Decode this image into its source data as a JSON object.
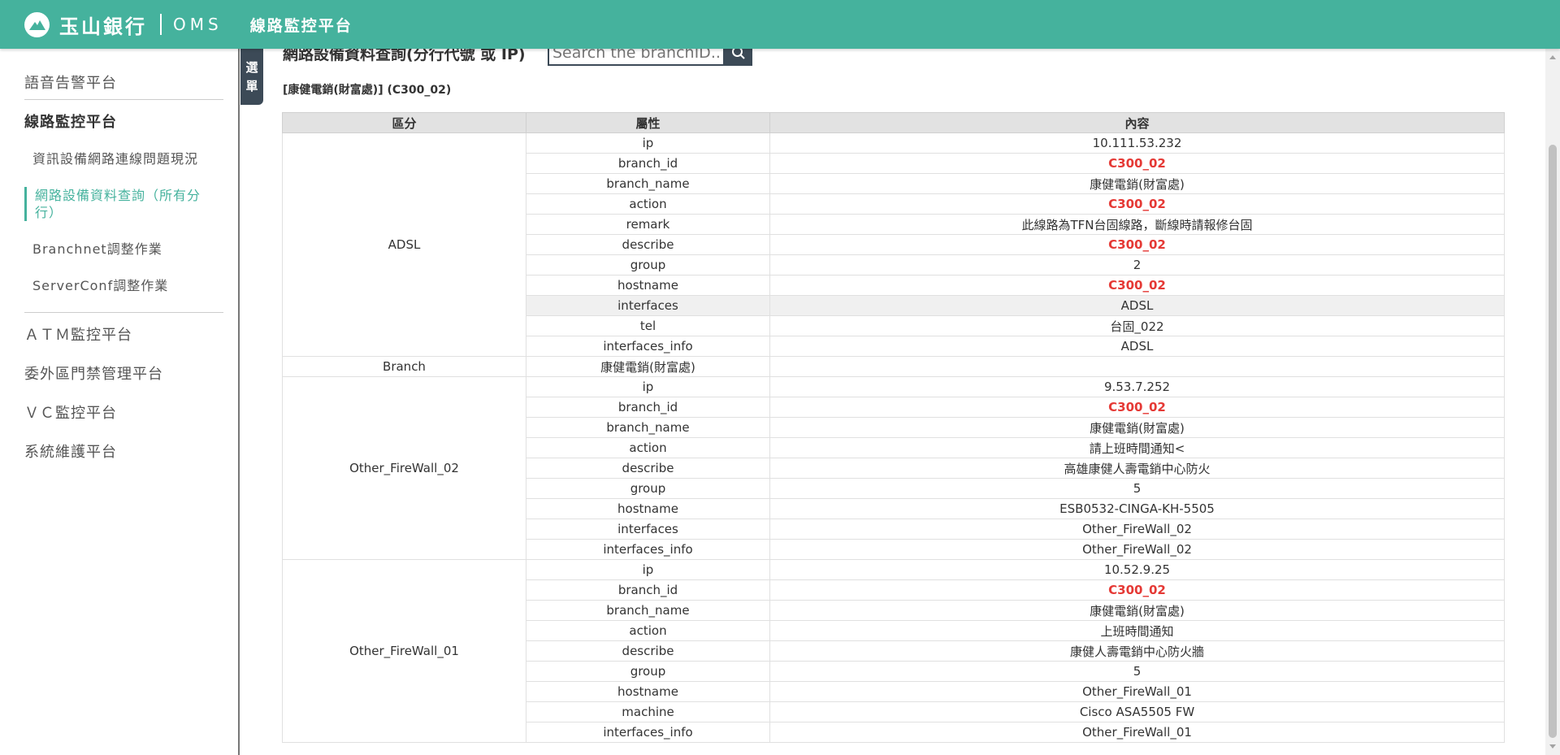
{
  "header": {
    "logo_text": "玉山銀行",
    "system": "OMS",
    "platform": "線路監控平台"
  },
  "sidebar": {
    "items": [
      {
        "label": "語音告警平台"
      },
      {
        "label": "線路監控平台"
      },
      {
        "label": "資訊設備網路連線問題現況"
      },
      {
        "label": "網路設備資料查詢（所有分行）"
      },
      {
        "label": "Branchnet調整作業"
      },
      {
        "label": "ServerConf調整作業"
      },
      {
        "label": "ＡＴＭ監控平台"
      },
      {
        "label": "委外區門禁管理平台"
      },
      {
        "label": "ＶＣ監控平台"
      },
      {
        "label": "系統維護平台"
      }
    ],
    "toggle": [
      "選",
      "單"
    ]
  },
  "search": {
    "title": "網路設備資料查詢(分行代號 或 IP)",
    "placeholder": "Search the branchID...",
    "icon": "search-icon"
  },
  "result": {
    "heading": "[康健電銷(財富處)] (C300_02)"
  },
  "table": {
    "headers": [
      "區分",
      "屬性",
      "內容"
    ],
    "groups": [
      {
        "name": "ADSL",
        "rows": [
          {
            "attr": "ip",
            "value": "10.111.53.232",
            "hl": false
          },
          {
            "attr": "branch_id",
            "value": "C300_02",
            "hl": true
          },
          {
            "attr": "branch_name",
            "value": "康健電銷(財富處)",
            "hl": false
          },
          {
            "attr": "action",
            "value": "C300_02",
            "hl": true
          },
          {
            "attr": "remark",
            "value": "此線路為TFN台固線路，斷線時請報修台固",
            "hl": false
          },
          {
            "attr": "describe",
            "value": "C300_02",
            "hl": true
          },
          {
            "attr": "group",
            "value": "2",
            "hl": false
          },
          {
            "attr": "hostname",
            "value": "C300_02",
            "hl": true
          },
          {
            "attr": "interfaces",
            "value": "ADSL",
            "hl": false,
            "shade": true
          },
          {
            "attr": "tel",
            "value": "台固_022",
            "hl": false
          },
          {
            "attr": "interfaces_info",
            "value": "ADSL",
            "hl": false
          }
        ]
      },
      {
        "name": "Branch",
        "rows": [
          {
            "attr": "康健電銷(財富處)",
            "value": "",
            "hl": false
          }
        ]
      },
      {
        "name": "Other_FireWall_02",
        "rows": [
          {
            "attr": "ip",
            "value": "9.53.7.252",
            "hl": false
          },
          {
            "attr": "branch_id",
            "value": "C300_02",
            "hl": true
          },
          {
            "attr": "branch_name",
            "value": "康健電銷(財富處)",
            "hl": false
          },
          {
            "attr": "action",
            "value": "請上班時間通知<",
            "hl": false
          },
          {
            "attr": "describe",
            "value": "高雄康健人壽電銷中心防火",
            "hl": false
          },
          {
            "attr": "group",
            "value": "5",
            "hl": false
          },
          {
            "attr": "hostname",
            "value": "ESB0532-CINGA-KH-5505",
            "hl": false
          },
          {
            "attr": "interfaces",
            "value": "Other_FireWall_02",
            "hl": false
          },
          {
            "attr": "interfaces_info",
            "value": "Other_FireWall_02",
            "hl": false
          }
        ]
      },
      {
        "name": "Other_FireWall_01",
        "rows": [
          {
            "attr": "ip",
            "value": "10.52.9.25",
            "hl": false
          },
          {
            "attr": "branch_id",
            "value": "C300_02",
            "hl": true
          },
          {
            "attr": "branch_name",
            "value": "康健電銷(財富處)",
            "hl": false
          },
          {
            "attr": "action",
            "value": "上班時間通知",
            "hl": false
          },
          {
            "attr": "describe",
            "value": "康健人壽電銷中心防火牆",
            "hl": false
          },
          {
            "attr": "group",
            "value": "5",
            "hl": false
          },
          {
            "attr": "hostname",
            "value": "Other_FireWall_01",
            "hl": false
          },
          {
            "attr": "machine",
            "value": "Cisco ASA5505 FW",
            "hl": false
          },
          {
            "attr": "interfaces_info",
            "value": "Other_FireWall_01",
            "hl": false
          }
        ]
      }
    ]
  },
  "colors": {
    "header_bg": "#45b29d",
    "accent": "#45b29d",
    "highlight": "#e53935",
    "dark": "#3c4a57"
  }
}
